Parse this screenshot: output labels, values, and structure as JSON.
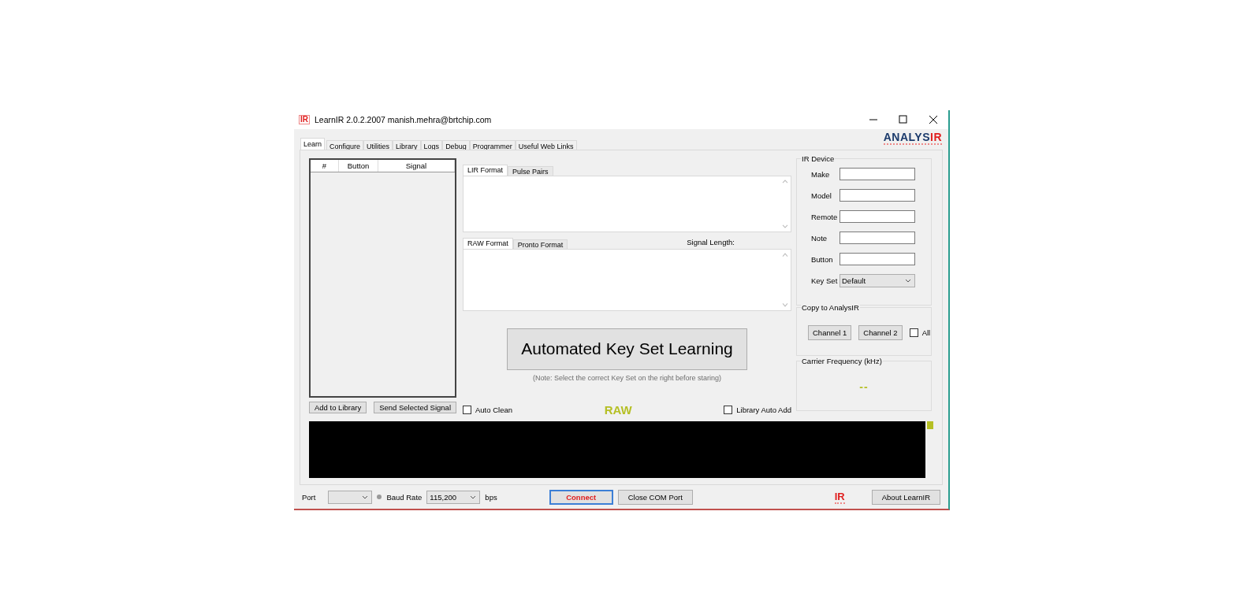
{
  "window": {
    "title": "LearnIR 2.0.2.2007 manish.mehra@brtchip.com",
    "app_icon": "IR"
  },
  "tabs": [
    {
      "label": "Learn",
      "selected": true
    },
    {
      "label": "Configure",
      "selected": false
    },
    {
      "label": "Utilities",
      "selected": false
    },
    {
      "label": "Library",
      "selected": false
    },
    {
      "label": "Logs",
      "selected": false
    },
    {
      "label": "Debug",
      "selected": false
    },
    {
      "label": "Programmer",
      "selected": false
    },
    {
      "label": "Useful Web Links",
      "selected": false
    }
  ],
  "logo": {
    "main": "ANALYS",
    "accent": "IR"
  },
  "signal_list": {
    "columns": [
      "#",
      "Button",
      "Signal"
    ]
  },
  "list_buttons": [
    "Add to Library",
    "Send Selected Signal"
  ],
  "lir_tabs": [
    {
      "label": "LIR Format",
      "selected": true
    },
    {
      "label": "Pulse Pairs",
      "selected": false
    }
  ],
  "raw_tabs": [
    {
      "label": "RAW Format",
      "selected": true
    },
    {
      "label": "Pronto Format",
      "selected": false
    }
  ],
  "signal_length_label": "Signal Length:",
  "automated_button": "Automated Key Set Learning",
  "note": "(Note: Select the correct Key Set on the right before staring)",
  "auto_clean": {
    "label": "Auto Clean",
    "checked": false
  },
  "mode_label": "RAW",
  "library_auto_add": {
    "label": "Library Auto Add",
    "checked": false
  },
  "ir_device": {
    "title": "IR Device",
    "fields": [
      {
        "label": "Make",
        "kind": "text"
      },
      {
        "label": "Model",
        "kind": "text"
      },
      {
        "label": "Remote",
        "kind": "text"
      },
      {
        "label": "Note",
        "kind": "text"
      },
      {
        "label": "Button",
        "kind": "text"
      },
      {
        "label": "Key Set",
        "kind": "select",
        "value": "Default"
      }
    ]
  },
  "copy_to": {
    "title": "Copy to AnalysIR",
    "buttons": [
      "Channel 1",
      "Channel 2"
    ],
    "all": {
      "label": "All",
      "checked": false
    }
  },
  "carrier": {
    "title": "Carrier Frequency (kHz)",
    "value": "--"
  },
  "bottom": {
    "port_label": "Port",
    "baud_label": "Baud Rate",
    "baud_value": "115,200",
    "bps_label": "bps",
    "connect": "Connect",
    "close_port": "Close COM Port",
    "ir_icon": "IR",
    "about": "About LearnIR"
  }
}
